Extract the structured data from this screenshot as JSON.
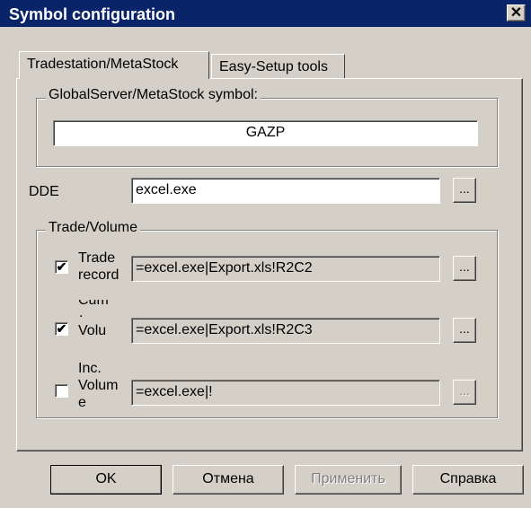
{
  "window": {
    "title": "Symbol configuration",
    "close_glyph": "✕"
  },
  "tabs": [
    {
      "label": "Tradestation/MetaStock",
      "active": true
    },
    {
      "label": "Easy-Setup tools",
      "active": false
    }
  ],
  "symbol_group": {
    "title": "GlobalServer/MetaStock symbol:",
    "value": "GAZP"
  },
  "dde": {
    "label": "DDE",
    "value": "excel.exe",
    "browse_label": "..."
  },
  "trade_volume": {
    "title": "Trade/Volume",
    "rows": [
      {
        "label_lines": [
          "Trade",
          "record"
        ],
        "checked": true,
        "check_glyph": "✔",
        "value": "=excel.exe|Export.xls!R2C2",
        "browse_label": "...",
        "enabled": true
      },
      {
        "label_lines": [
          "Cum",
          ".",
          "Volu"
        ],
        "checked": true,
        "check_glyph": "✔",
        "value": "=excel.exe|Export.xls!R2C3",
        "browse_label": "...",
        "enabled": true
      },
      {
        "label_lines": [
          "Inc.",
          "Volum",
          "e"
        ],
        "checked": false,
        "check_glyph": "",
        "value": "=excel.exe|!",
        "browse_label": "...",
        "enabled": false
      }
    ]
  },
  "buttons": {
    "ok": "OK",
    "cancel": "Отмена",
    "apply": "Применить",
    "help": "Справка"
  },
  "colors": {
    "face": "#d4d0c8",
    "titlebar": "#0a246a",
    "disabled_text": "#808080"
  }
}
